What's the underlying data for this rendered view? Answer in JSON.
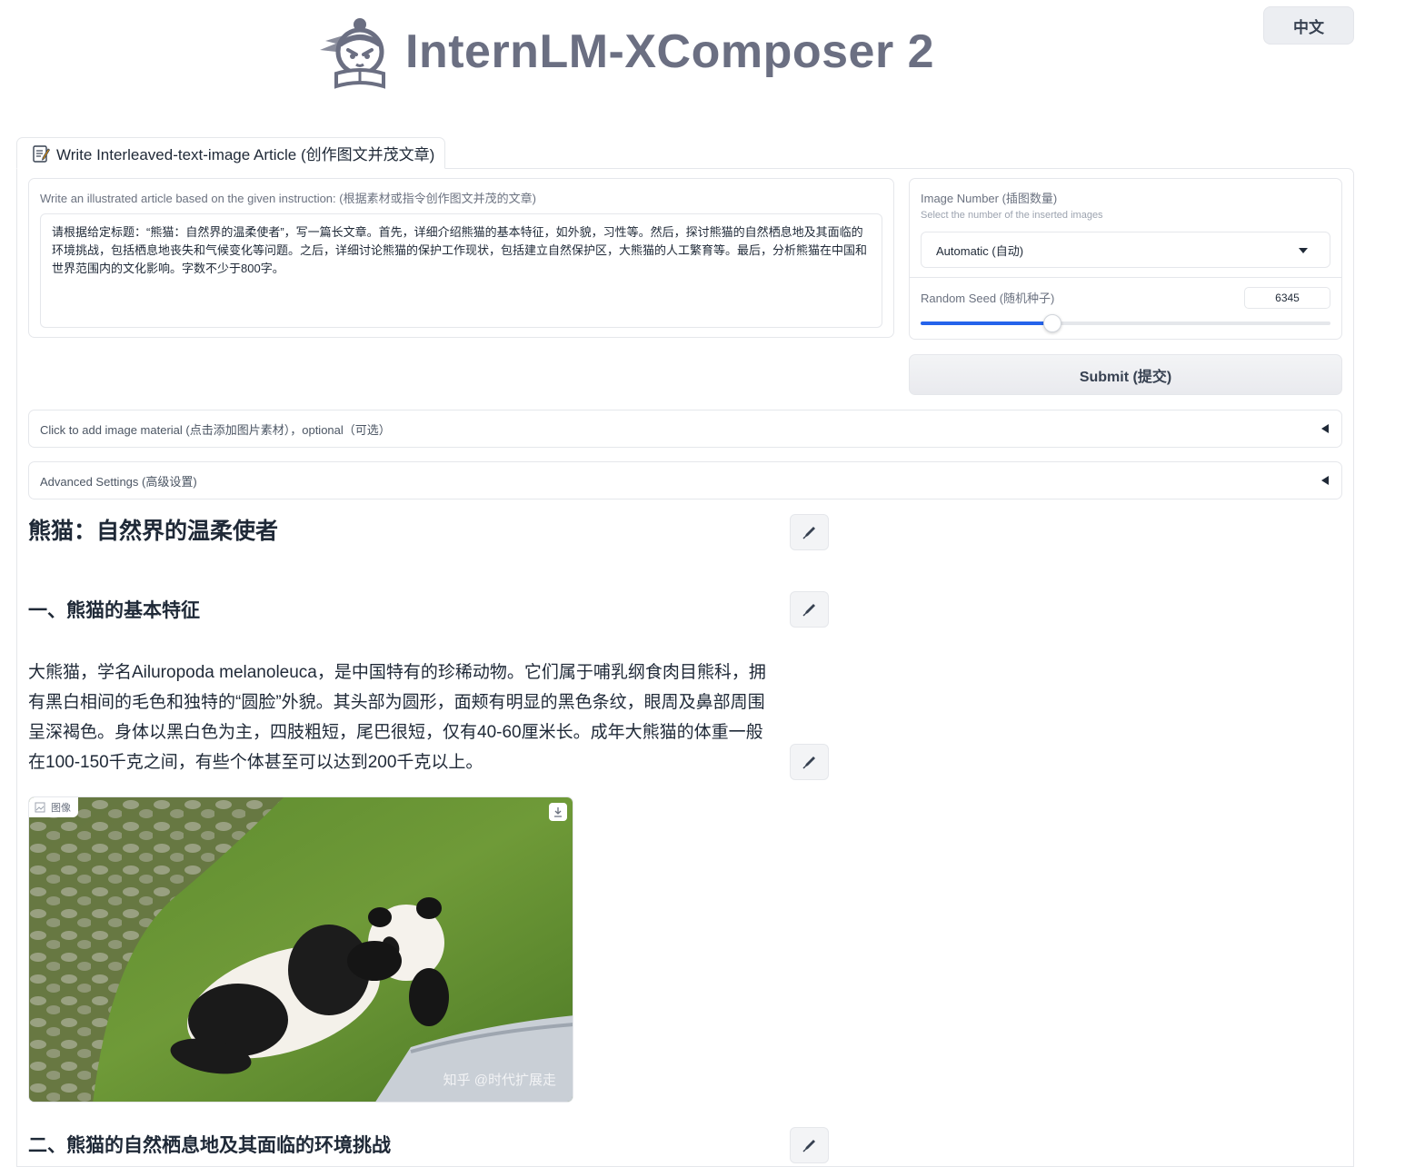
{
  "header": {
    "logo_text": "InternLM-XComposer 2",
    "lang_button": "中文"
  },
  "tab": {
    "label": "Write Interleaved-text-image Article (创作图文并茂文章)"
  },
  "instruction": {
    "label": "Write an illustrated article based on the given instruction: (根据素材或指令创作图文并茂的文章)",
    "value": "请根据给定标题：“熊猫：自然界的温柔使者”，写一篇长文章。首先，详细介绍熊猫的基本特征，如外貌，习性等。然后，探讨熊猫的自然栖息地及其面临的环境挑战，包括栖息地丧失和气候变化等问题。之后，详细讨论熊猫的保护工作现状，包括建立自然保护区，大熊猫的人工繁育等。最后，分析熊猫在中国和世界范围内的文化影响。字数不少于800字。"
  },
  "image_number": {
    "label": "Image Number (插图数量)",
    "sublabel": "Select the number of the inserted images",
    "selected": "Automatic (自动)"
  },
  "seed": {
    "label": "Random Seed (随机种子)",
    "value": "6345",
    "slider_fraction": 0.32
  },
  "submit_label": "Submit (提交)",
  "accordions": {
    "image_material": "Click to add image material (点击添加图片素材），optional（可选）",
    "advanced": "Advanced Settings (高级设置)"
  },
  "article": {
    "title": "熊猫：自然界的温柔使者",
    "section1_heading": "一、熊猫的基本特征",
    "section1_para": "大熊猫，学名Ailuropoda melanoleuca，是中国特有的珍稀动物。它们属于哺乳纲食肉目熊科，拥有黑白相间的毛色和独特的“圆脸”外貌。其头部为圆形，面颊有明显的黑色条纹，眼周及鼻部周围呈深褐色。身体以黑白色为主，四肢粗短，尾巴很短，仅有40-60厘米长。成年大熊猫的体重一般在100-150千克之间，有些个体甚至可以达到200千克以上。",
    "image_label": "图像",
    "image_watermark": "知乎 @时代扩展走",
    "section2_heading": "二、熊猫的自然栖息地及其面临的环境挑战"
  },
  "colors": {
    "accent": "#2563eb",
    "logo_text": "#6b6f82"
  }
}
